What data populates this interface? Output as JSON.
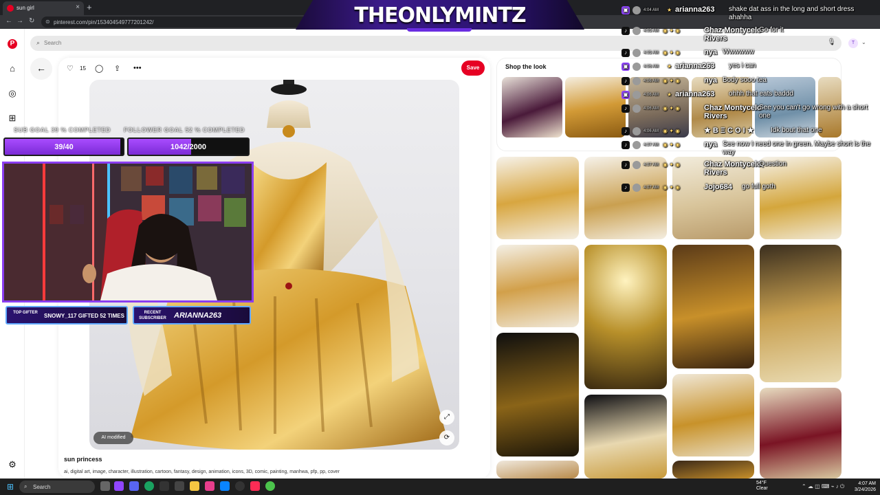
{
  "browser": {
    "tab_title": "sun girl",
    "url": "pinterest.com/pin/153404549777201242/"
  },
  "banner": {
    "title": "THEONLYMINTZ"
  },
  "search": {
    "placeholder": "Search",
    "avatar_initial": "T"
  },
  "pin": {
    "likes": "15",
    "save_label": "Save",
    "ai_badge": "AI modified",
    "title": "sun princess",
    "tags": "ai, digital art, image, character, illustration, cartoon, fantasy, design, animation, icons, 3D, comic, painting, manhwa, pfp, pp, cover"
  },
  "shop": {
    "title": "Shop the look"
  },
  "overlay": {
    "sub_goal_label": "SUB GOAL 39 % COMPLETED",
    "follower_goal_label": "FOLLOWER GOAL 52 % COMPLETED",
    "sub_goal_value": "39/40",
    "sub_goal_progress": 0.975,
    "follower_goal_value": "1042/2000",
    "follower_goal_progress": 0.521,
    "top_gifter_key": "TOP GIFTER",
    "top_gifter_value": "SNOWY_117 GIFTED 52 TIMES",
    "recent_sub_key": "RECENT SUBSCRIBER",
    "recent_sub_value": "ARIANNA263"
  },
  "chat": [
    {
      "platform": "twitch",
      "time": "4:04 AM",
      "name": "arianna263",
      "message": "shake dat ass in the long and short dress ahahha"
    },
    {
      "platform": "tiktok",
      "time": "4:05 AM",
      "name": "Chaz Montycelo Rivers",
      "message": "Go for it"
    },
    {
      "platform": "tiktok",
      "time": "4:05 AM",
      "name": "nya",
      "message": "Wwwwww"
    },
    {
      "platform": "twitch",
      "time": "4:06 AM",
      "name": "arianna263",
      "message": "yes i can"
    },
    {
      "platform": "tiktok",
      "time": "4:06 AM",
      "name": "nya",
      "message": "Body sooo tea"
    },
    {
      "platform": "twitch",
      "time": "4:06 AM",
      "name": "arianna263",
      "message": "ohhh that eats baddd"
    },
    {
      "platform": "tiktok",
      "time": "4:06 AM",
      "name": "Chaz Montycelo Rivers",
      "message": "See you can't go wrong with a short one"
    },
    {
      "platform": "tiktok",
      "time": "4:06 AM",
      "name": "★ B Ξ C O I ★",
      "message": "Idk bout that one"
    },
    {
      "platform": "tiktok",
      "time": "4:07 AM",
      "name": "nya",
      "message": "See now I need one in green. Maybe short is the way"
    },
    {
      "platform": "tiktok",
      "time": "4:07 AM",
      "name": "Chaz Montycelo Rivers",
      "message": "Question"
    },
    {
      "platform": "tiktok",
      "time": "4:07 AM",
      "name": "Jojo684",
      "message": "go full goth"
    }
  ],
  "taskbar": {
    "search_label": "Search",
    "weather_temp": "54°F",
    "weather_desc": "Clear",
    "time": "4:07 AM",
    "date": "3/24/2026"
  },
  "colors": {
    "pinterest_red": "#e60023",
    "twitch_purple": "#9146ff",
    "overlay_purple": "#8a3df0",
    "overlay_blue": "#5fa8ff"
  }
}
